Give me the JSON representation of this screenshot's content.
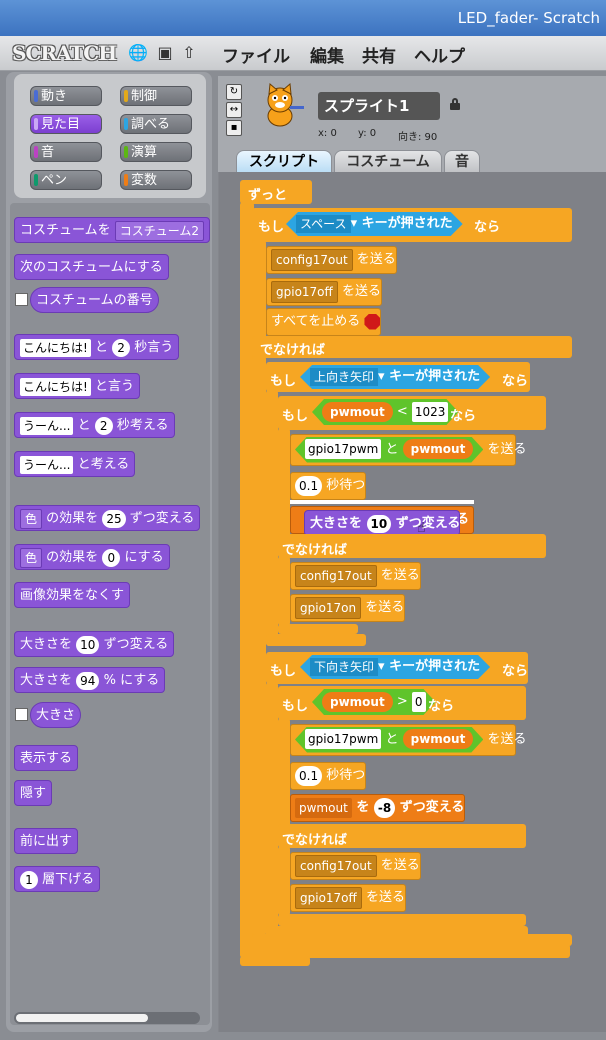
{
  "window": {
    "title": "LED_fader- Scratch"
  },
  "menu": {
    "logo": "SCRATCH",
    "items": [
      "ファイル",
      "編集",
      "共有",
      "ヘルプ"
    ]
  },
  "categories": [
    "動き",
    "制御",
    "見た目",
    "調べる",
    "音",
    "演算",
    "ペン",
    "変数"
  ],
  "category_colors": [
    "#4a6cd4",
    "#e1a91a",
    "#8a55d7",
    "#2ca5e2",
    "#bb42c3",
    "#5cb712",
    "#0e9a6c",
    "#ee7d16"
  ],
  "palette": {
    "switch_costume": "コスチュームを",
    "costume_name": "コスチューム2",
    "next_costume": "次のコスチュームにする",
    "costume_number": "コスチュームの番号",
    "say_hello": "こんにちは!",
    "say_for_mid": "と",
    "say_secs": "2",
    "say_for_end": "秒言う",
    "say_end": "と言う",
    "think_hmm": "うーん...",
    "think_secs": "2",
    "think_for_end": "秒考える",
    "think_end": "と考える",
    "effect_color": "色",
    "effect_change_mid": "の効果を",
    "effect_change_val": "25",
    "effect_change_end": "ずつ変える",
    "effect_set_val": "0",
    "effect_set_end": "にする",
    "clear_effects": "画像効果をなくす",
    "size_change": "大きさを",
    "size_change_val": "10",
    "size_change_end": "ずつ変える",
    "size_set_val": "94",
    "size_set_end": "% にする",
    "size": "大きさ",
    "show": "表示する",
    "hide": "隠す",
    "go_front": "前に出す",
    "go_back_val": "1",
    "go_back_end": "層下げる"
  },
  "sprite": {
    "name": "スプライト1",
    "x_label": "x: 0",
    "y_label": "y: 0",
    "dir_label": "向き: 90"
  },
  "tabs": [
    "スクリプト",
    "コスチューム",
    "音"
  ],
  "script": {
    "forever": "ずっと",
    "if": "もし",
    "then": "なら",
    "else": "でなければ",
    "key_pressed": "キーが押された",
    "key_space": "スペース",
    "key_up": "上向き矢印",
    "key_down": "下向き矢印",
    "broadcast": "を送る",
    "msg_config17out": "config17out",
    "msg_gpio17off": "gpio17off",
    "msg_gpio17on": "gpio17on",
    "stop_all": "すべてを止める",
    "var_pwmout": "pwmout",
    "lt": "<",
    "gt": ">",
    "val_1023": "1023",
    "val_0": "0",
    "join_text": "gpio17pwm",
    "join_and": "と",
    "wait_val": "0.1",
    "wait_end": "秒待つ",
    "change_by": "を",
    "change_val_neg": "-8",
    "change_end": "ずつ変える",
    "drag_size": "大きさを",
    "drag_size_val": "10",
    "drag_size_end": "ずつ変える",
    "hidden_fragment": "る"
  }
}
